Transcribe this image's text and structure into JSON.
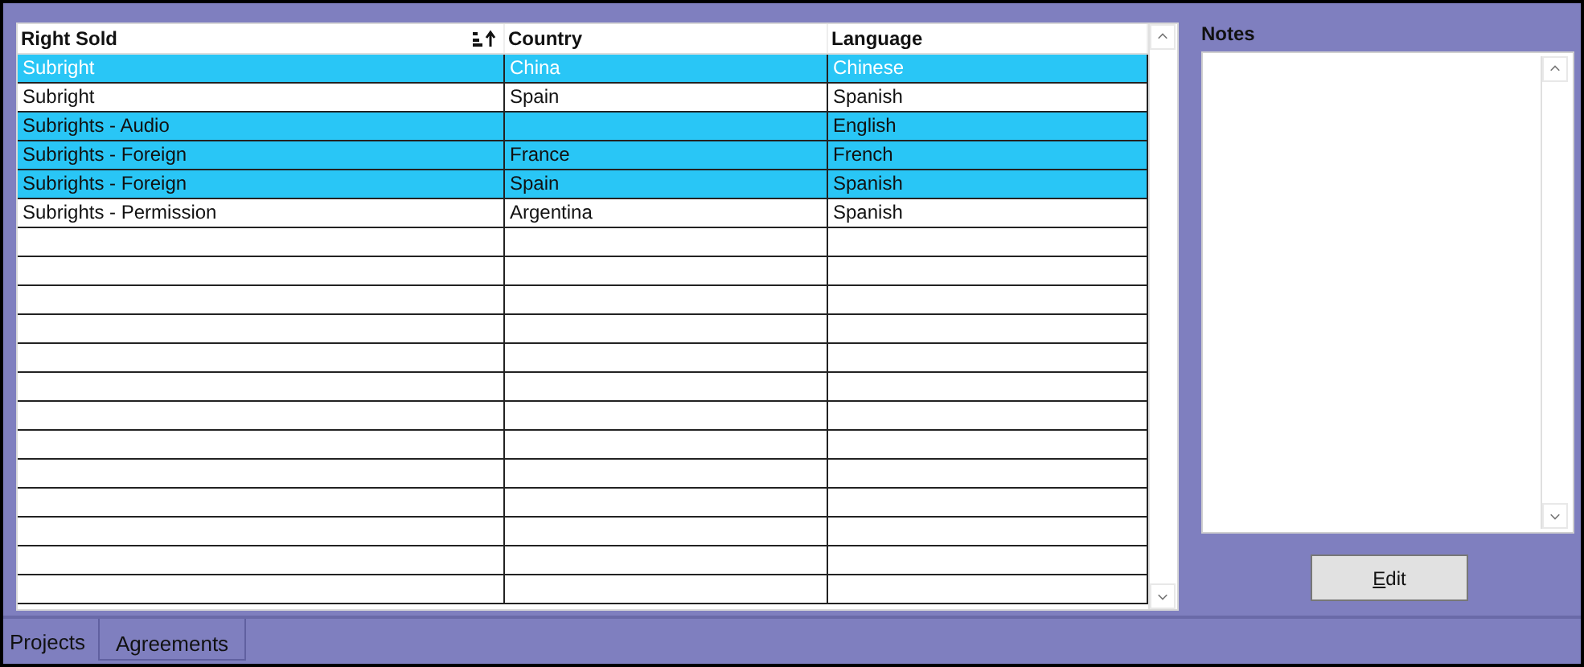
{
  "table": {
    "columns": [
      {
        "label": "Right Sold",
        "sorted": true
      },
      {
        "label": "Country",
        "sorted": false
      },
      {
        "label": "Language",
        "sorted": false
      }
    ],
    "rows": [
      {
        "cells": [
          "Subright",
          "China",
          "Chinese"
        ],
        "selected": true,
        "focused": true
      },
      {
        "cells": [
          "Subright",
          "Spain",
          "Spanish"
        ],
        "selected": false,
        "focused": false
      },
      {
        "cells": [
          "Subrights - Audio",
          "",
          "English"
        ],
        "selected": true,
        "focused": false
      },
      {
        "cells": [
          "Subrights - Foreign",
          "France",
          "French"
        ],
        "selected": true,
        "focused": false
      },
      {
        "cells": [
          "Subrights - Foreign",
          "Spain",
          "Spanish"
        ],
        "selected": true,
        "focused": false
      },
      {
        "cells": [
          "Subrights - Permission",
          "Argentina",
          "Spanish"
        ],
        "selected": false,
        "focused": false
      }
    ]
  },
  "notes": {
    "label": "Notes"
  },
  "edit_button": {
    "label": "Edit"
  },
  "tabs": [
    {
      "label": "Projects",
      "selected": true
    },
    {
      "label": "Agreements",
      "selected": false
    }
  ]
}
